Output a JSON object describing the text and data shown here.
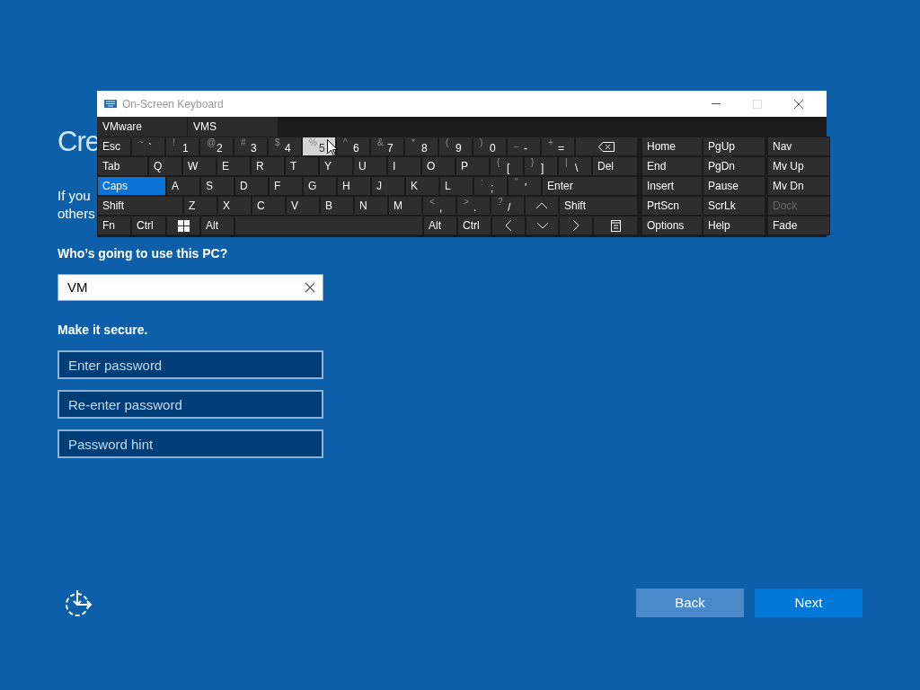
{
  "page": {
    "heading": "Cre",
    "intro_lines": [
      "If you",
      "others"
    ],
    "user_label": "Who’s going to use this PC?",
    "user_field": {
      "value": "VM"
    },
    "secure_label": "Make it secure.",
    "password_fields": [
      {
        "placeholder": "Enter password"
      },
      {
        "placeholder": "Re-enter password"
      },
      {
        "placeholder": "Password hint"
      }
    ],
    "buttons": [
      {
        "label": "Back",
        "kind": "secondary"
      },
      {
        "label": "Next",
        "kind": "primary"
      }
    ]
  },
  "keyboard": {
    "title": "On-Screen Keyboard",
    "maximize_disabled": true,
    "predictions": [
      "VMware",
      "VMS"
    ],
    "rows": [
      [
        {
          "label": "Esc",
          "hovered": false,
          "on": false
        },
        {
          "shift": "~",
          "label": "`",
          "hovered": false,
          "on": false
        },
        {
          "shift": "!",
          "label": "1",
          "hovered": false,
          "on": false
        },
        {
          "shift": "@",
          "label": "2",
          "hovered": false,
          "on": false
        },
        {
          "shift": "#",
          "label": "3",
          "hovered": false,
          "on": false
        },
        {
          "shift": "$",
          "label": "4",
          "hovered": false,
          "on": false
        },
        {
          "shift": "%",
          "label": "5",
          "hovered": true,
          "on": false
        },
        {
          "shift": "^",
          "label": "6",
          "hovered": false,
          "on": false
        },
        {
          "shift": "&",
          "label": "7",
          "hovered": false,
          "on": false
        },
        {
          "shift": "*",
          "label": "8",
          "hovered": false,
          "on": false
        },
        {
          "shift": "(",
          "label": "9",
          "hovered": false,
          "on": false
        },
        {
          "shift": ")",
          "label": "0",
          "hovered": false,
          "on": false
        },
        {
          "shift": "_",
          "label": "-",
          "hovered": false,
          "on": false
        },
        {
          "shift": "+",
          "label": "=",
          "hovered": false,
          "on": false
        },
        {
          "kind": "backspace",
          "hovered": false,
          "on": false
        }
      ],
      [
        {
          "label": "Tab",
          "hovered": false,
          "on": false
        },
        {
          "label": "Q",
          "hovered": false,
          "on": false
        },
        {
          "label": "W",
          "hovered": false,
          "on": false
        },
        {
          "label": "E",
          "hovered": false,
          "on": false
        },
        {
          "label": "R",
          "hovered": false,
          "on": false
        },
        {
          "label": "T",
          "hovered": false,
          "on": false
        },
        {
          "label": "Y",
          "hovered": false,
          "on": false
        },
        {
          "label": "U",
          "hovered": false,
          "on": false
        },
        {
          "label": "I",
          "hovered": false,
          "on": false
        },
        {
          "label": "O",
          "hovered": false,
          "on": false
        },
        {
          "label": "P",
          "hovered": false,
          "on": false
        },
        {
          "shift": "{",
          "label": "[",
          "hovered": false,
          "on": false
        },
        {
          "shift": "}",
          "label": "]",
          "hovered": false,
          "on": false
        },
        {
          "shift": "|",
          "label": "\\",
          "hovered": false,
          "on": false
        },
        {
          "label": "Del",
          "hovered": false,
          "on": false
        }
      ],
      [
        {
          "label": "Caps",
          "hovered": false,
          "on": true
        },
        {
          "label": "A",
          "hovered": false,
          "on": false
        },
        {
          "label": "S",
          "hovered": false,
          "on": false
        },
        {
          "label": "D",
          "hovered": false,
          "on": false
        },
        {
          "label": "F",
          "hovered": false,
          "on": false
        },
        {
          "label": "G",
          "hovered": false,
          "on": false
        },
        {
          "label": "H",
          "hovered": false,
          "on": false
        },
        {
          "label": "J",
          "hovered": false,
          "on": false
        },
        {
          "label": "K",
          "hovered": false,
          "on": false
        },
        {
          "label": "L",
          "hovered": false,
          "on": false
        },
        {
          "shift": ":",
          "label": ";",
          "hovered": false,
          "on": false
        },
        {
          "shift": "\"",
          "label": "'",
          "hovered": false,
          "on": false
        },
        {
          "label": "Enter",
          "hovered": false,
          "on": false
        }
      ],
      [
        {
          "label": "Shift",
          "hovered": false,
          "on": false
        },
        {
          "label": "Z",
          "hovered": false,
          "on": false
        },
        {
          "label": "X",
          "hovered": false,
          "on": false
        },
        {
          "label": "C",
          "hovered": false,
          "on": false
        },
        {
          "label": "V",
          "hovered": false,
          "on": false
        },
        {
          "label": "B",
          "hovered": false,
          "on": false
        },
        {
          "label": "N",
          "hovered": false,
          "on": false
        },
        {
          "label": "M",
          "hovered": false,
          "on": false
        },
        {
          "shift": "<",
          "label": ",",
          "hovered": false,
          "on": false
        },
        {
          "shift": ">",
          "label": ".",
          "hovered": false,
          "on": false
        },
        {
          "shift": "?",
          "label": "/",
          "hovered": false,
          "on": false
        },
        {
          "kind": "up",
          "hovered": false,
          "on": false
        },
        {
          "label": "Shift",
          "hovered": false,
          "on": false
        }
      ],
      [
        {
          "label": "Fn",
          "hovered": false,
          "on": false
        },
        {
          "label": "Ctrl",
          "hovered": false,
          "on": false
        },
        {
          "kind": "windows",
          "hovered": false,
          "on": false
        },
        {
          "label": "Alt",
          "hovered": false,
          "on": false
        },
        {
          "kind": "space",
          "hovered": false,
          "on": false
        },
        {
          "label": "Alt",
          "hovered": false,
          "on": false
        },
        {
          "label": "Ctrl",
          "hovered": false,
          "on": false
        },
        {
          "kind": "left",
          "hovered": false,
          "on": false
        },
        {
          "kind": "down",
          "hovered": false,
          "on": false
        },
        {
          "kind": "right",
          "hovered": false,
          "on": false
        },
        {
          "kind": "menu",
          "hovered": false,
          "on": false
        }
      ]
    ],
    "side_rows": [
      [
        {
          "label": "Home",
          "disabled": false
        },
        {
          "label": "PgUp",
          "disabled": false
        },
        {
          "label": "Nav",
          "disabled": false
        }
      ],
      [
        {
          "label": "End",
          "disabled": false
        },
        {
          "label": "PgDn",
          "disabled": false
        },
        {
          "label": "Mv Up",
          "disabled": false
        }
      ],
      [
        {
          "label": "Insert",
          "disabled": false
        },
        {
          "label": "Pause",
          "disabled": false
        },
        {
          "label": "Mv Dn",
          "disabled": false
        }
      ],
      [
        {
          "label": "PrtScn",
          "disabled": false
        },
        {
          "label": "ScrLk",
          "disabled": false
        },
        {
          "label": "Dock",
          "disabled": true
        }
      ],
      [
        {
          "label": "Options",
          "disabled": false
        },
        {
          "label": "Help",
          "disabled": false
        },
        {
          "label": "Fade",
          "disabled": false
        }
      ]
    ]
  }
}
